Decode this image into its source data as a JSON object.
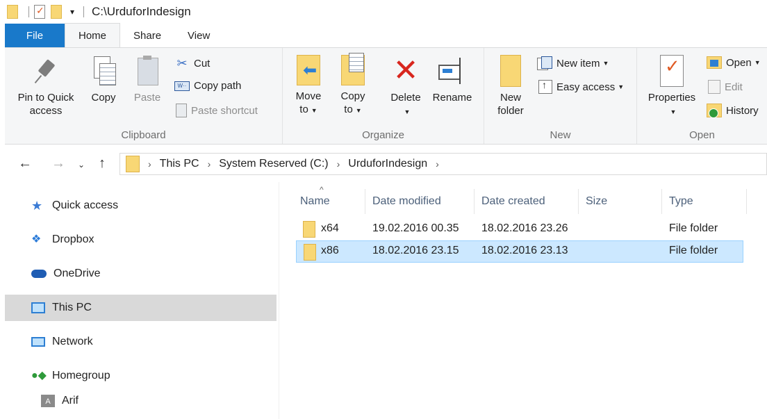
{
  "window": {
    "title_path": "C:\\UrduforIndesign"
  },
  "tabs": {
    "file": "File",
    "home": "Home",
    "share": "Share",
    "view": "View"
  },
  "ribbon": {
    "clipboard": {
      "label": "Clipboard",
      "pin_line1": "Pin to Quick",
      "pin_line2": "access",
      "copy": "Copy",
      "paste": "Paste",
      "cut": "Cut",
      "copy_path": "Copy path",
      "paste_shortcut": "Paste shortcut"
    },
    "organize": {
      "label": "Organize",
      "move_line1": "Move",
      "move_line2": "to",
      "copy_line1": "Copy",
      "copy_line2": "to",
      "delete": "Delete",
      "rename": "Rename"
    },
    "new": {
      "label": "New",
      "folder_line1": "New",
      "folder_line2": "folder",
      "new_item": "New item",
      "easy_access": "Easy access"
    },
    "open": {
      "label": "Open",
      "properties": "Properties",
      "open": "Open",
      "edit": "Edit",
      "history": "History"
    }
  },
  "address": {
    "crumbs": [
      "This PC",
      "System Reserved (C:)",
      "UrduforIndesign"
    ]
  },
  "nav": {
    "items": [
      {
        "label": "Quick access",
        "icon": "quick-access-star-icon"
      },
      {
        "label": "Dropbox",
        "icon": "dropbox-icon"
      },
      {
        "label": "OneDrive",
        "icon": "onedrive-cloud-icon"
      },
      {
        "label": "This PC",
        "icon": "computer-icon"
      },
      {
        "label": "Network",
        "icon": "network-icon"
      },
      {
        "label": "Homegroup",
        "icon": "homegroup-icon"
      },
      {
        "label": "Arif",
        "icon": "user-icon"
      }
    ],
    "user_initial": "A"
  },
  "files": {
    "columns": [
      "Name",
      "Date modified",
      "Date created",
      "Size",
      "Type"
    ],
    "rows": [
      {
        "name": "x64",
        "modified": "19.02.2016 00.35",
        "created": "18.02.2016 23.26",
        "size": "",
        "type": "File folder"
      },
      {
        "name": "x86",
        "modified": "18.02.2016 23.15",
        "created": "18.02.2016 23.13",
        "size": "",
        "type": "File folder"
      }
    ]
  }
}
